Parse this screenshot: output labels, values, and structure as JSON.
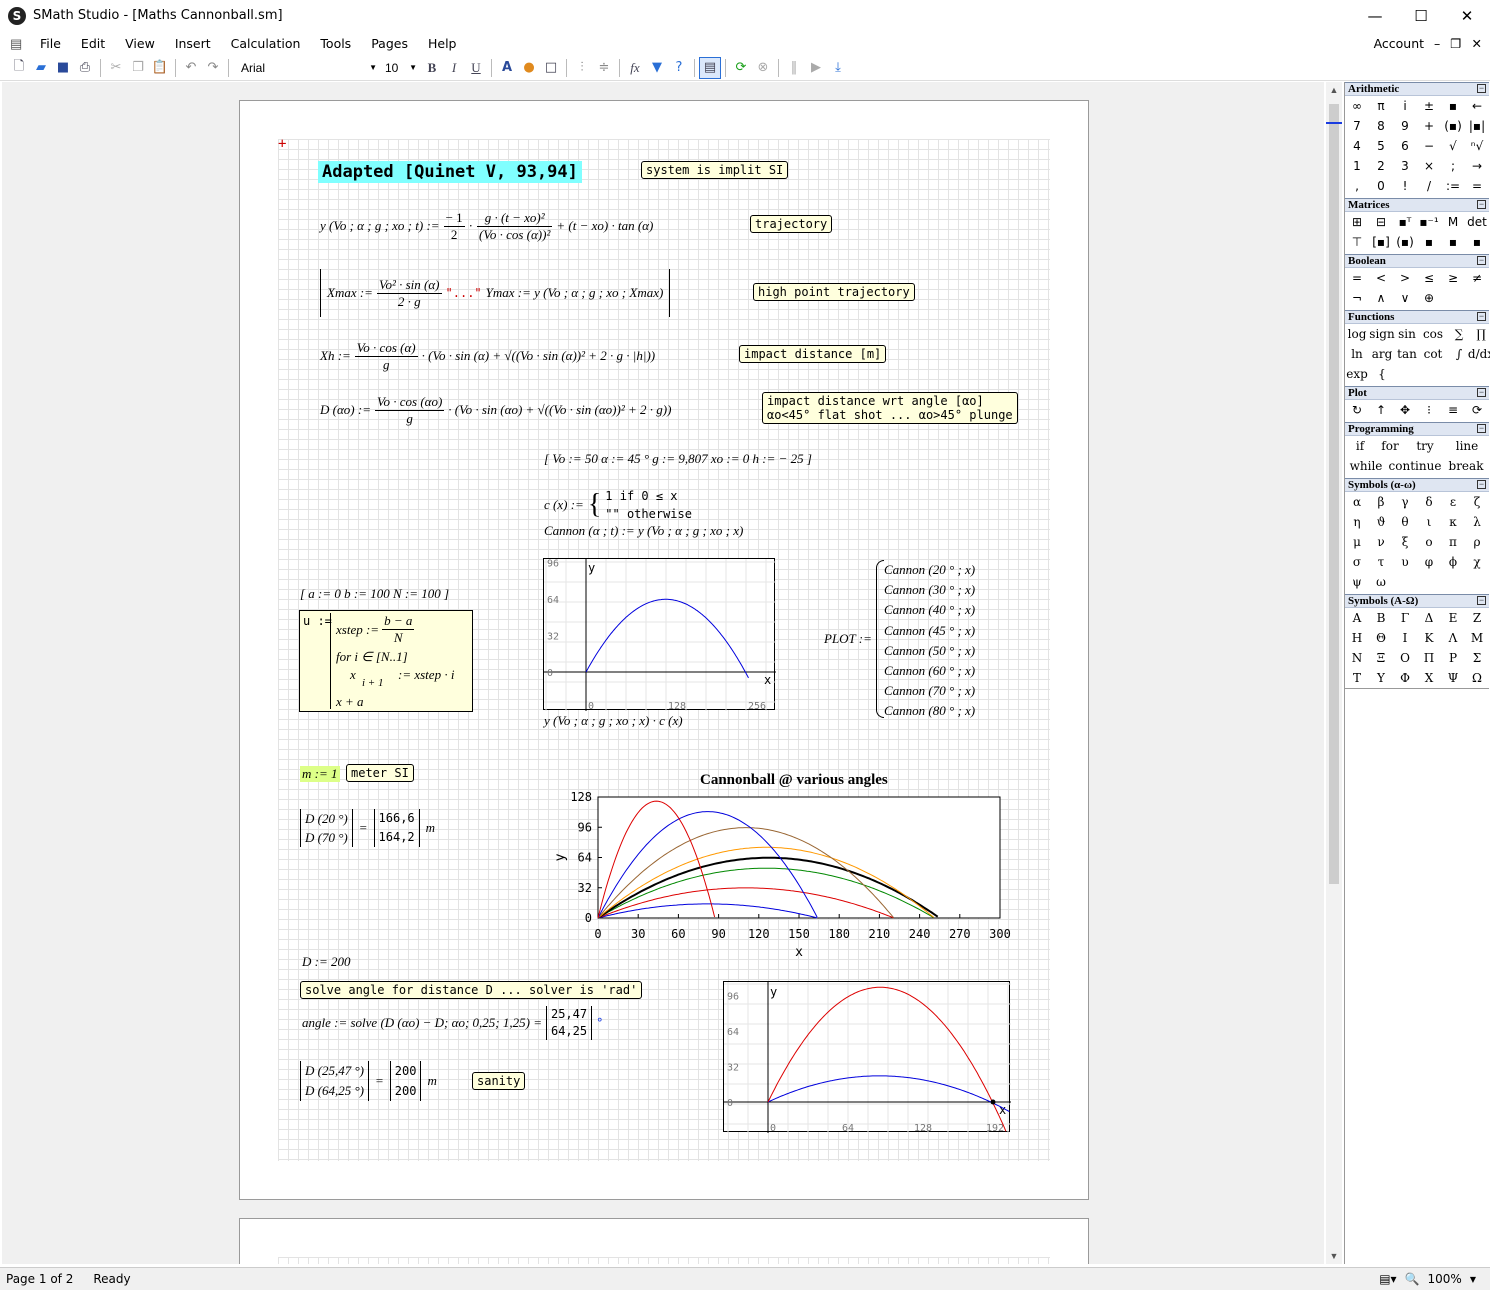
{
  "window": {
    "app_logo": "S",
    "title": "SMath Studio - [Maths Cannonball.sm]",
    "minimize": "—",
    "maximize": "☐",
    "close": "✕"
  },
  "menu": {
    "items": [
      "File",
      "Edit",
      "View",
      "Insert",
      "Calculation",
      "Tools",
      "Pages",
      "Help"
    ],
    "account": "Account"
  },
  "toolbar": {
    "font_name": "Arial",
    "font_size": "10",
    "bold": "B",
    "italic": "I",
    "underline": "U",
    "fx": "fx"
  },
  "doc": {
    "heading": "Adapted [Quinet V, 93,94]",
    "note_si": "system is implit SI",
    "note_trajectory": "trajectory",
    "note_high_point": "high point trajectory",
    "note_impact": "impact distance [m]",
    "note_impact_angle": "impact distance wrt angle [αo]\nαo<45° flat shot ... αo>45° plunge",
    "eq_y_lhs": "y (Vo ; α ; g ; xo ; t) :=",
    "eq_y_frac1_num": "− 1",
    "eq_y_frac1_den": "2",
    "eq_y_frac2_num": "g · (t − xo)²",
    "eq_y_frac2_den": "(Vo · cos (α))²",
    "eq_y_tail": "+ (t − xo) · tan (α)",
    "eq_xmax_lhs": "Xmax :=",
    "eq_xmax_num": "Vo² · sin (α)",
    "eq_xmax_den": "2 · g",
    "eq_xmax_str": "\"...\"",
    "eq_ymax": "Ymax := y (Vo ; α ; g ; xo ; Xmax)",
    "eq_xh_lhs": "Xh :=",
    "eq_xh_num": "Vo · cos (α)",
    "eq_xh_den": "g",
    "eq_xh_tail": "· (Vo · sin (α) + √((Vo · sin (α))² + 2 · g · |h|))",
    "eq_d_lhs": "D (αo) :=",
    "eq_d_num": "Vo · cos (αo)",
    "eq_d_den": "g",
    "eq_d_tail": "· (Vo · sin (αo) + √((Vo · sin (αo))² + 2 · g))",
    "params": "[ Vo := 50  α := 45 °  g := 9,807  xo := 0  h := − 25 ]",
    "c_lhs": "c (x) :=",
    "c_case1": "1   if  0 ≤ x",
    "c_case2": "\"\"  otherwise",
    "cannon_def": "Cannon (α ; t) := y (Vo ; α ; g ; xo ; x)",
    "range_def": "[ a := 0  b := 100  N := 100 ]",
    "prog_u": "u :=",
    "prog_xstep": "xstep :=",
    "prog_xstep_num": "b − a",
    "prog_xstep_den": "N",
    "prog_for": "for  i ∈ [N..1]",
    "prog_assign": "x",
    "prog_assign_sub": "i + 1",
    "prog_assign_rhs": ":= xstep · i",
    "prog_ret": "x + a",
    "plot1_caption": "y (Vo ; α ; g ; xo ; x) · c (x)",
    "plot_list_lhs": "PLOT :=",
    "plot_list": [
      "Cannon (20 ° ; x)",
      "Cannon (30 ° ; x)",
      "Cannon (40 ° ; x)",
      "Cannon (45 ° ; x)",
      "Cannon (50 ° ; x)",
      "Cannon (60 ° ; x)",
      "Cannon (70 ° ; x)",
      "Cannon (80 ° ; x)"
    ],
    "m_def": "m := 1",
    "note_meter": "meter SI",
    "d_eval_1": "D (20 °)",
    "d_eval_2": "D (70 °)",
    "d_res_1": "166,6",
    "d_res_2": "164,2",
    "unit_m": "m",
    "D_def": "D := 200",
    "note_solve": "solve angle for distance D ... solver is 'rad'",
    "solve_expr": "angle := solve (D (αo) − D; αo; 0,25; 1,25) =",
    "solve_res_1": "25,47",
    "solve_res_2": "64,25",
    "deg": "°",
    "sanity_1": "D (25,47 °)",
    "sanity_2": "D (64,25 °)",
    "sanity_res_1": "200",
    "sanity_res_2": "200",
    "note_sanity": "sanity",
    "equals": "="
  },
  "chart_data": [
    {
      "type": "line",
      "axis_x_label": "x",
      "axis_y_label": "y",
      "x_ticks": [
        0,
        128,
        256
      ],
      "y_ticks": [
        0,
        32,
        64,
        96
      ],
      "series": [
        {
          "color": "#0000dd",
          "angle_deg": 45,
          "x": [
            0,
            63.7,
            127.4,
            191.2,
            250
          ],
          "y": [
            0,
            47.8,
            63.7,
            47.8,
            5
          ]
        }
      ]
    },
    {
      "type": "line",
      "title": "Cannonball @ various angles",
      "xlabel": "x",
      "ylabel": "y",
      "xlim": [
        0,
        300
      ],
      "ylim": [
        0,
        128
      ],
      "x_ticks": [
        0,
        30,
        60,
        90,
        120,
        150,
        180,
        210,
        240,
        270,
        300
      ],
      "y_ticks": [
        0,
        32,
        64,
        96,
        128
      ],
      "series": [
        {
          "angle_deg": 20,
          "color": "#0000dd"
        },
        {
          "angle_deg": 30,
          "color": "#dd0000"
        },
        {
          "angle_deg": 40,
          "color": "#008800"
        },
        {
          "angle_deg": 45,
          "color": "#000000"
        },
        {
          "angle_deg": 50,
          "color": "#ff9900"
        },
        {
          "angle_deg": 60,
          "color": "#996633"
        },
        {
          "angle_deg": 70,
          "color": "#0000dd"
        },
        {
          "angle_deg": 80,
          "color": "#dd0000"
        }
      ]
    },
    {
      "type": "line",
      "axis_x_label": "x",
      "axis_y_label": "y",
      "x_ticks": [
        0,
        64,
        128,
        192
      ],
      "y_ticks": [
        0,
        32,
        64,
        96
      ],
      "series": [
        {
          "angle_deg": 25.47,
          "color": "#0000dd"
        },
        {
          "angle_deg": 64.25,
          "color": "#dd0000"
        }
      ]
    }
  ],
  "panel": {
    "arithmetic_title": "Arithmetic",
    "arithmetic": [
      "∞",
      "π",
      "i",
      "±",
      "▪",
      "←",
      "7",
      "8",
      "9",
      "+",
      "(▪)",
      "|▪|",
      "4",
      "5",
      "6",
      "−",
      "√",
      "ⁿ√",
      "1",
      "2",
      "3",
      "×",
      ";",
      "→",
      ",",
      "0",
      "!",
      "/",
      ":=",
      "="
    ],
    "matrices_title": "Matrices",
    "matrices": [
      "⊞",
      "⊟",
      "▪ᵀ",
      "▪⁻¹",
      "M",
      "det",
      "⊤",
      "[▪]",
      "(▪)",
      "▪",
      "▪",
      "▪"
    ],
    "boolean_title": "Boolean",
    "boolean": [
      "=",
      "<",
      ">",
      "≤",
      "≥",
      "≠",
      "¬",
      "∧",
      "∨",
      "⊕"
    ],
    "functions_title": "Functions",
    "functions": [
      "log",
      "sign",
      "sin",
      "cos",
      "∑",
      "∏",
      "ln",
      "arg",
      "tan",
      "cot",
      "∫",
      "d/dx",
      "exp",
      "{"
    ],
    "plot_title": "Plot",
    "plot": [
      "↻",
      "↑",
      "✥",
      "⁝",
      "≡",
      "⟳"
    ],
    "programming_title": "Programming",
    "programming_row1": [
      "if",
      "for",
      "try",
      "line"
    ],
    "programming_row2": [
      "while",
      "continue",
      "break"
    ],
    "greek_lower_title": "Symbols (α-ω)",
    "greek_lower": [
      "α",
      "β",
      "γ",
      "δ",
      "ε",
      "ζ",
      "η",
      "ϑ",
      "θ",
      "ι",
      "κ",
      "λ",
      "μ",
      "ν",
      "ξ",
      "ο",
      "π",
      "ρ",
      "σ",
      "τ",
      "υ",
      "φ",
      "ϕ",
      "χ",
      "ψ",
      "ω"
    ],
    "greek_upper_title": "Symbols (Α-Ω)",
    "greek_upper": [
      "Α",
      "Β",
      "Γ",
      "Δ",
      "Ε",
      "Ζ",
      "Η",
      "Θ",
      "Ι",
      "Κ",
      "Λ",
      "Μ",
      "Ν",
      "Ξ",
      "Ο",
      "Π",
      "Ρ",
      "Σ",
      "Τ",
      "Υ",
      "Φ",
      "Χ",
      "Ψ",
      "Ω"
    ],
    "collapse": "−"
  },
  "status": {
    "page": "Page 1 of 2",
    "state": "Ready",
    "zoom": "100%"
  }
}
